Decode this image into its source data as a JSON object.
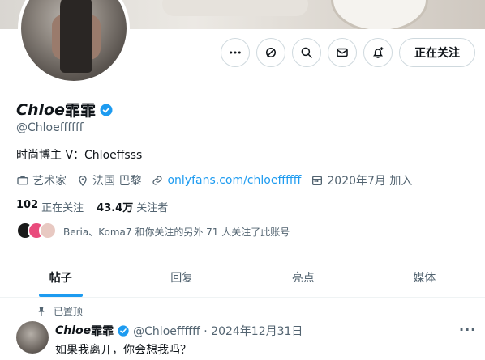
{
  "profile": {
    "display_name_italic": "Chloe",
    "display_name_cjk": "霏霏",
    "handle": "@Chloeffffff",
    "bio": "时尚博主 V：Chloeffsss",
    "meta": {
      "profession": "艺术家",
      "location": "法国 巴黎",
      "link": "onlyfans.com/chloeffffff",
      "joined": "2020年7月 加入"
    },
    "stats": {
      "following_count": "102",
      "following_label": "正在关注",
      "followers_count": "43.4万",
      "followers_label": "关注者"
    },
    "followed_by_text": "Beria、Koma7 和你关注的另外 71 人关注了此账号"
  },
  "actions": {
    "follow_label": "正在关注"
  },
  "tabs": [
    "帖子",
    "回复",
    "亮点",
    "媒体"
  ],
  "pinned_post": {
    "pinned_label": "已置顶",
    "author_italic": "Chloe",
    "author_cjk": "霏霏",
    "meta": "@Chloeffffff · 2024年12月31日",
    "text": "如果我离开，你会想我吗？",
    "more": "···"
  },
  "colors": {
    "accent": "#1d9bf0",
    "text": "#0f1419",
    "secondary": "#536471"
  }
}
